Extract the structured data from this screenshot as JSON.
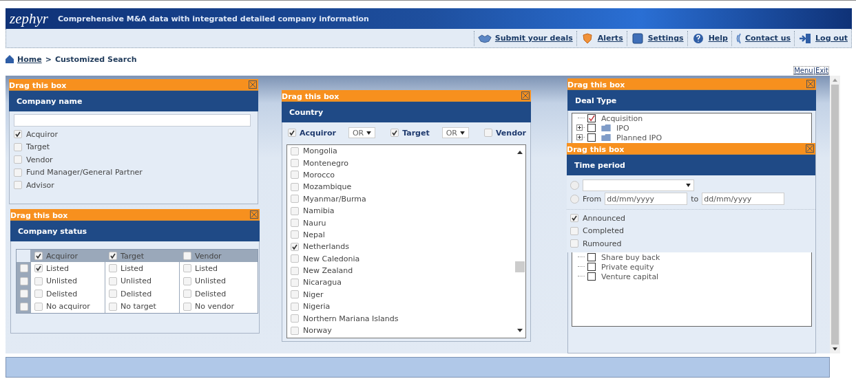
{
  "header": {
    "logo": "zephyr",
    "tagline": "Comprehensive M&A data with integrated detailed company information"
  },
  "nav": [
    {
      "label": "Submit your deals"
    },
    {
      "label": "Alerts"
    },
    {
      "label": "Settings"
    },
    {
      "label": "Help"
    },
    {
      "label": "Contact us"
    },
    {
      "label": "Log out"
    }
  ],
  "breadcrumb": {
    "home": "Home",
    "separator": ">",
    "current": "Customized Search"
  },
  "canvas_links": {
    "menu": "Menu",
    "separator": "|",
    "exit": "Exit"
  },
  "company_name": {
    "drag_label": "Drag this box",
    "title": "Company name",
    "options": [
      {
        "label": "Acquiror",
        "checked": true
      },
      {
        "label": "Target",
        "checked": false
      },
      {
        "label": "Vendor",
        "checked": false
      },
      {
        "label": "Fund Manager/General Partner",
        "checked": false
      },
      {
        "label": "Advisor",
        "checked": false
      }
    ]
  },
  "company_status": {
    "drag_label": "Drag this box",
    "title": "Company status",
    "row_toggles": [
      {
        "checked": false
      },
      {
        "checked": false
      },
      {
        "checked": false
      },
      {
        "checked": false
      }
    ],
    "columns": [
      {
        "label": "Acquiror",
        "checked": true,
        "rows": [
          {
            "label": "Listed",
            "checked": true
          },
          {
            "label": "Unlisted",
            "checked": false
          },
          {
            "label": "Delisted",
            "checked": false
          },
          {
            "label": "No acquiror",
            "checked": false
          }
        ]
      },
      {
        "label": "Target",
        "checked": true,
        "rows": [
          {
            "label": "Listed",
            "checked": false
          },
          {
            "label": "Unlisted",
            "checked": false
          },
          {
            "label": "Delisted",
            "checked": false
          },
          {
            "label": "No target",
            "checked": false
          }
        ]
      },
      {
        "label": "Vendor",
        "checked": false,
        "rows": [
          {
            "label": "Listed",
            "checked": false
          },
          {
            "label": "Unlisted",
            "checked": false
          },
          {
            "label": "Delisted",
            "checked": false
          },
          {
            "label": "No vendor",
            "checked": false
          }
        ]
      }
    ]
  },
  "country": {
    "drag_label": "Drag this box",
    "title": "Country",
    "roles": [
      {
        "label": "Acquiror",
        "checked": true,
        "operator": "OR"
      },
      {
        "label": "Target",
        "checked": true,
        "operator": "OR"
      },
      {
        "label": "Vendor",
        "checked": false
      }
    ],
    "list": [
      {
        "name": "Mongolia",
        "checked": false
      },
      {
        "name": "Montenegro",
        "checked": false
      },
      {
        "name": "Morocco",
        "checked": false
      },
      {
        "name": "Mozambique",
        "checked": false
      },
      {
        "name": "Myanmar/Burma",
        "checked": false
      },
      {
        "name": "Namibia",
        "checked": false
      },
      {
        "name": "Nauru",
        "checked": false
      },
      {
        "name": "Nepal",
        "checked": false
      },
      {
        "name": "Netherlands",
        "checked": true
      },
      {
        "name": "New Caledonia",
        "checked": false
      },
      {
        "name": "New Zealand",
        "checked": false
      },
      {
        "name": "Nicaragua",
        "checked": false
      },
      {
        "name": "Niger",
        "checked": false
      },
      {
        "name": "Nigeria",
        "checked": false
      },
      {
        "name": "Northern Mariana Islands",
        "checked": false
      },
      {
        "name": "Norway",
        "checked": false
      }
    ]
  },
  "deal_type": {
    "drag_label": "Drag this box",
    "title": "Deal Type",
    "tree": [
      {
        "label": "Acquisition",
        "checked": true,
        "kind": "leaf"
      },
      {
        "label": "IPO",
        "checked": false,
        "kind": "folder"
      },
      {
        "label": "Planned IPO",
        "checked": false,
        "kind": "folder"
      },
      {
        "label": "Share buy back",
        "checked": false,
        "kind": "leaf"
      },
      {
        "label": "Private equity",
        "checked": false,
        "kind": "leaf"
      },
      {
        "label": "Venture capital",
        "checked": false,
        "kind": "leaf"
      }
    ]
  },
  "time_period": {
    "drag_label": "Drag this box",
    "title": "Time period",
    "preset": {
      "selected": false
    },
    "range": {
      "selected": false,
      "from_label": "From",
      "from_placeholder": "dd/mm/yyyy",
      "to_label": "to",
      "to_placeholder": "dd/mm/yyyy"
    },
    "statuses": [
      {
        "label": "Announced",
        "checked": true
      },
      {
        "label": "Completed",
        "checked": false
      },
      {
        "label": "Rumoured",
        "checked": false
      }
    ]
  }
}
